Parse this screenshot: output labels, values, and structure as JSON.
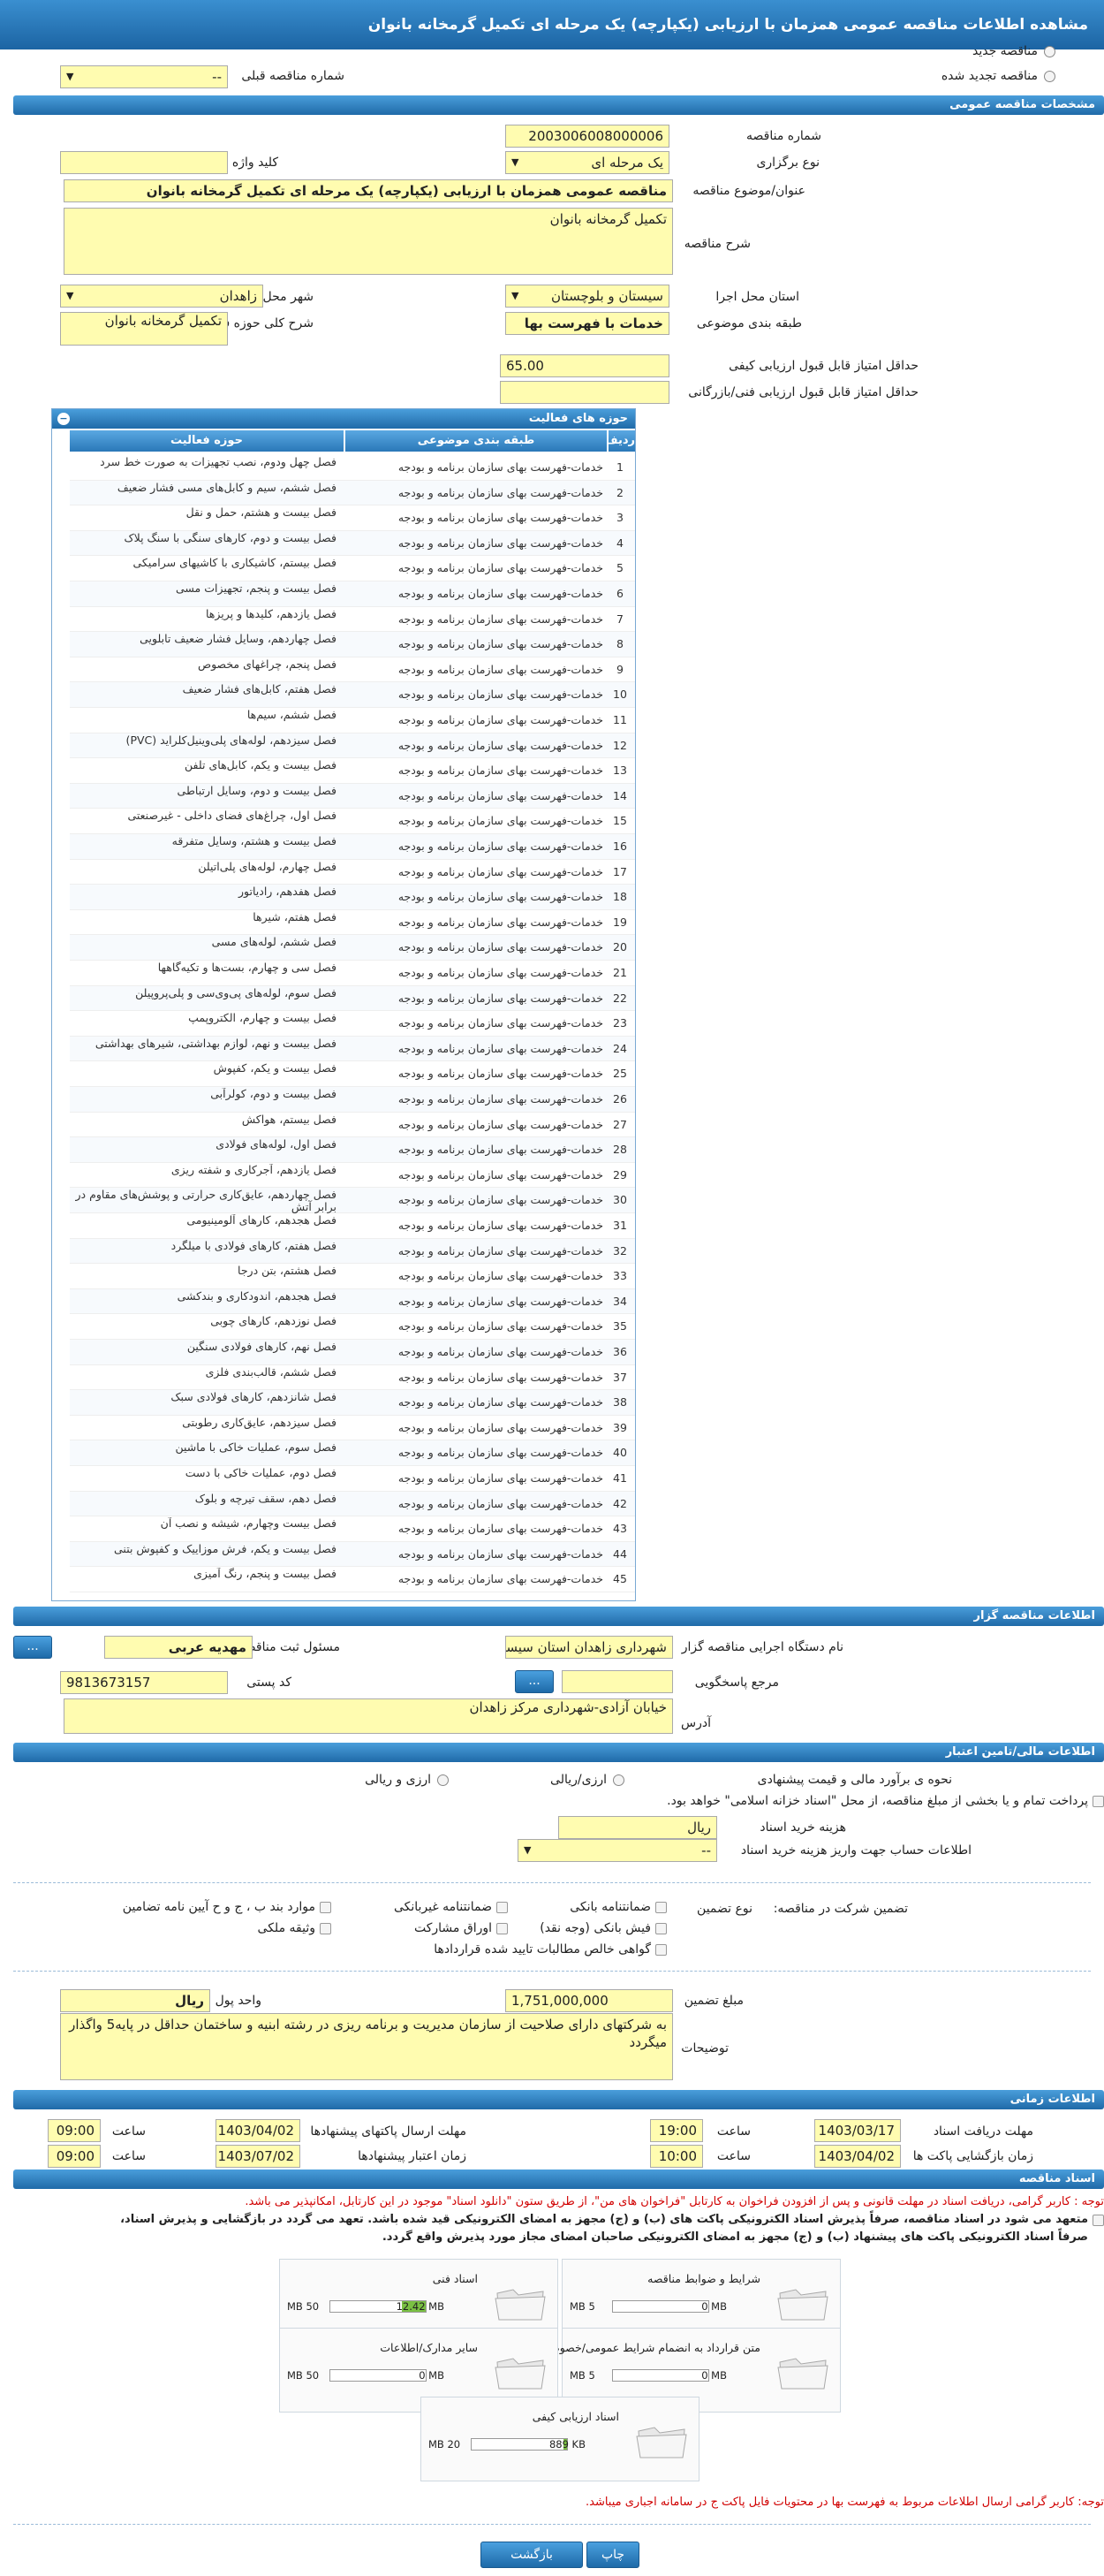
{
  "page_title": "مشاهده اطلاعات مناقصه عمومی همزمان با ارزیابی (یکپارچه) یک مرحله ای تکمیل گرمخانه بانوان",
  "top": {
    "new_tender": "مناقصه جدید",
    "renewed_tender": "مناقصه تجدید شده",
    "prev_number_label": "شماره مناقصه قبلی",
    "prev_number_value": "--"
  },
  "sections": {
    "general": "مشخصات مناقصه عمومی",
    "activity": "حوزه های فعالیت",
    "organizer": "اطلاعات مناقصه گزار",
    "financial": "اطلاعات مالی/تامین اعتبار",
    "timing": "اطلاعات زمانی",
    "docs": "اسناد مناقصه"
  },
  "general": {
    "number_label": "شماره مناقصه",
    "number": "2003006008000006",
    "type_label": "نوع برگزاری",
    "type": "یک مرحله ای",
    "keyword_label": "کلید واژه",
    "keyword": "",
    "subject_label": "عنوان/موضوع مناقصه",
    "subject": "مناقصه عمومی همزمان با ارزیابی (یکپارچه) یک مرحله ای تکمیل گرمخانه بانوان",
    "desc_label": "شرح مناقصه",
    "desc": "تکمیل گرمخانه بانوان",
    "province_label": "استان محل اجرا",
    "province": "سیستان و بلوچستان",
    "city_label": "شهر محل اجرا",
    "city": "زاهدان",
    "category_label": "طبقه بندی موضوعی",
    "category": "خدمات با فهرست بها",
    "scope_label": "شرح کلی حوزه فعالیت",
    "scope": "تکمیل گرمخانه بانوان",
    "min_quality_label": "حداقل امتیاز قابل قبول ارزیابی کیفی",
    "min_quality": "65.00",
    "min_tech_label": "حداقل امتیاز قابل قبول ارزیابی فنی/بازرگانی",
    "min_tech": ""
  },
  "activity_table": {
    "col_row": "ردیف",
    "col_cat": "طبقه بندی موضوعی",
    "col_field": "حوزه فعالیت",
    "rows": [
      {
        "n": "1",
        "cat": "خدمات-فهرست بهای سازمان برنامه و بودجه",
        "field": "فصل چهل ودوم، نصب تجهیزات به صورت خط سرد"
      },
      {
        "n": "2",
        "cat": "خدمات-فهرست بهای سازمان برنامه و بودجه",
        "field": "فصل ششم، سیم و کابل‌های مسی فشار ضعیف"
      },
      {
        "n": "3",
        "cat": "خدمات-فهرست بهای سازمان برنامه و بودجه",
        "field": "فصل بیست و هشتم، حمل و نقل"
      },
      {
        "n": "4",
        "cat": "خدمات-فهرست بهای سازمان برنامه و بودجه",
        "field": "فصل بیست و دوم، کارهای سنگی با سنگ پلاک"
      },
      {
        "n": "5",
        "cat": "خدمات-فهرست بهای سازمان برنامه و بودجه",
        "field": "فصل بیستم، کاشیکاری با کاشیهای سرامیکی"
      },
      {
        "n": "6",
        "cat": "خدمات-فهرست بهای سازمان برنامه و بودجه",
        "field": "فصل بیست و پنجم، تجهیزات مسی"
      },
      {
        "n": "7",
        "cat": "خدمات-فهرست بهای سازمان برنامه و بودجه",
        "field": "فصل یازدهم، کلیدها و پریزها"
      },
      {
        "n": "8",
        "cat": "خدمات-فهرست بهای سازمان برنامه و بودجه",
        "field": "فصل چهاردهم، وسایل فشار ضعیف تابلویی"
      },
      {
        "n": "9",
        "cat": "خدمات-فهرست بهای سازمان برنامه و بودجه",
        "field": "فصل پنجم، چراغهای مخصوص"
      },
      {
        "n": "10",
        "cat": "خدمات-فهرست بهای سازمان برنامه و بودجه",
        "field": "فصل هفتم، کابل‌های فشار ضعیف"
      },
      {
        "n": "11",
        "cat": "خدمات-فهرست بهای سازمان برنامه و بودجه",
        "field": "فصل ششم، سیم‌ها"
      },
      {
        "n": "12",
        "cat": "خدمات-فهرست بهای سازمان برنامه و بودجه",
        "field": "فصل سیزدهم، لوله‌های پلی‌وینیل‌کلراید (PVC)"
      },
      {
        "n": "13",
        "cat": "خدمات-فهرست بهای سازمان برنامه و بودجه",
        "field": "فصل بیست و یکم، کابل‌های تلفن"
      },
      {
        "n": "14",
        "cat": "خدمات-فهرست بهای سازمان برنامه و بودجه",
        "field": "فصل بیست و دوم، وسایل ارتباطی"
      },
      {
        "n": "15",
        "cat": "خدمات-فهرست بهای سازمان برنامه و بودجه",
        "field": "فصل اول، چراغ‌های فضای داخلی - غیرصنعتی"
      },
      {
        "n": "16",
        "cat": "خدمات-فهرست بهای سازمان برنامه و بودجه",
        "field": "فصل بیست و هشتم، وسایل متفرقه"
      },
      {
        "n": "17",
        "cat": "خدمات-فهرست بهای سازمان برنامه و بودجه",
        "field": "فصل چهارم، لوله‌های پلی‌اتیلن"
      },
      {
        "n": "18",
        "cat": "خدمات-فهرست بهای سازمان برنامه و بودجه",
        "field": "فصل هفدهم، رادیاتور"
      },
      {
        "n": "19",
        "cat": "خدمات-فهرست بهای سازمان برنامه و بودجه",
        "field": "فصل هفتم، شیرها"
      },
      {
        "n": "20",
        "cat": "خدمات-فهرست بهای سازمان برنامه و بودجه",
        "field": "فصل ششم، لوله‌های مسی"
      },
      {
        "n": "21",
        "cat": "خدمات-فهرست بهای سازمان برنامه و بودجه",
        "field": "فصل سی و چهارم، بست‌ها و تکیه‌گاهها"
      },
      {
        "n": "22",
        "cat": "خدمات-فهرست بهای سازمان برنامه و بودجه",
        "field": "فصل سوم، لوله‌های پی‌وی‌سی و پلی‌پروپیلن"
      },
      {
        "n": "23",
        "cat": "خدمات-فهرست بهای سازمان برنامه و بودجه",
        "field": "فصل بیست و چهارم، الکتروپمپ"
      },
      {
        "n": "24",
        "cat": "خدمات-فهرست بهای سازمان برنامه و بودجه",
        "field": "فصل بیست و نهم، لوازم بهداشتی، شیرهای بهداشتی"
      },
      {
        "n": "25",
        "cat": "خدمات-فهرست بهای سازمان برنامه و بودجه",
        "field": "فصل بیست و یکم، کفپوش"
      },
      {
        "n": "26",
        "cat": "خدمات-فهرست بهای سازمان برنامه و بودجه",
        "field": "فصل بیست و دوم، کولرآبی"
      },
      {
        "n": "27",
        "cat": "خدمات-فهرست بهای سازمان برنامه و بودجه",
        "field": "فصل بیستم، هواکش"
      },
      {
        "n": "28",
        "cat": "خدمات-فهرست بهای سازمان برنامه و بودجه",
        "field": "فصل اول، لوله‌های فولادی"
      },
      {
        "n": "29",
        "cat": "خدمات-فهرست بهای سازمان برنامه و بودجه",
        "field": "فصل یازدهم، آجرکاری و شفته ریزی"
      },
      {
        "n": "30",
        "cat": "خدمات-فهرست بهای سازمان برنامه و بودجه",
        "field": "فصل چهاردهم، عایق‌کاری حرارتی و پوشش‌های مقاوم در برابر آتش"
      },
      {
        "n": "31",
        "cat": "خدمات-فهرست بهای سازمان برنامه و بودجه",
        "field": "فصل هجدهم، کارهای آلومینیومی"
      },
      {
        "n": "32",
        "cat": "خدمات-فهرست بهای سازمان برنامه و بودجه",
        "field": "فصل هفتم، کارهای فولادی با میلگرد"
      },
      {
        "n": "33",
        "cat": "خدمات-فهرست بهای سازمان برنامه و بودجه",
        "field": "فصل هشتم، بتن درجا"
      },
      {
        "n": "34",
        "cat": "خدمات-فهرست بهای سازمان برنامه و بودجه",
        "field": "فصل هجدهم، اندودکاری و بندکشی"
      },
      {
        "n": "35",
        "cat": "خدمات-فهرست بهای سازمان برنامه و بودجه",
        "field": "فصل نوزدهم، کارهای چوبی"
      },
      {
        "n": "36",
        "cat": "خدمات-فهرست بهای سازمان برنامه و بودجه",
        "field": "فصل نهم، کارهای فولادی سنگین"
      },
      {
        "n": "37",
        "cat": "خدمات-فهرست بهای سازمان برنامه و بودجه",
        "field": "فصل ششم، قالب‌بندی فلزی"
      },
      {
        "n": "38",
        "cat": "خدمات-فهرست بهای سازمان برنامه و بودجه",
        "field": "فصل شانزدهم، کارهای فولادی سبک"
      },
      {
        "n": "39",
        "cat": "خدمات-فهرست بهای سازمان برنامه و بودجه",
        "field": "فصل سیزدهم، عایق‌کاری رطوبتی"
      },
      {
        "n": "40",
        "cat": "خدمات-فهرست بهای سازمان برنامه و بودجه",
        "field": "فصل سوم، عملیات خاکی با ماشین"
      },
      {
        "n": "41",
        "cat": "خدمات-فهرست بهای سازمان برنامه و بودجه",
        "field": "فصل دوم، عملیات خاکی با دست"
      },
      {
        "n": "42",
        "cat": "خدمات-فهرست بهای سازمان برنامه و بودجه",
        "field": "فصل دهم، سقف تیرچه و بلوک"
      },
      {
        "n": "43",
        "cat": "خدمات-فهرست بهای سازمان برنامه و بودجه",
        "field": "فصل بیست وچهارم، شیشه و نصب آن"
      },
      {
        "n": "44",
        "cat": "خدمات-فهرست بهای سازمان برنامه و بودجه",
        "field": "فصل بیست و یکم، فرش موزاییک و کفپوش بتنی"
      },
      {
        "n": "45",
        "cat": "خدمات-فهرست بهای سازمان برنامه و بودجه",
        "field": "فصل بیست و پنجم، رنگ آمیزی"
      }
    ]
  },
  "organizer": {
    "org_label": "نام دستگاه اجرایی مناقصه گزار",
    "org": "شهرداری زاهدان استان سیستان",
    "resp_label": "مسئول ثبت مناقصه",
    "resp": "مهدیه عربی",
    "ref_label": "مرجع پاسخگویی",
    "ref": "",
    "postal_label": "کد پستی",
    "postal": "9813673157",
    "address_label": "آدرس",
    "address": "خیابان آزادی-شهرداری مرکز زاهدان"
  },
  "financial": {
    "estimate_label": "نحوه ی برآورد مالی و قیمت پیشنهادی",
    "opt1": "ارزی/ریالی",
    "opt2": "ارزی و ریالی",
    "treasury_note": "پرداخت تمام و یا بخشی از مبلغ مناقصه، از محل \"اسناد خزانه اسلامی\" خواهد بود.",
    "doc_cost_label": "هزینه خرید اسناد",
    "doc_cost_unit": "ریال",
    "account_label": "اطلاعات حساب جهت واریز هزینه خرید اسناد",
    "account": "--",
    "guarantee_label": "تضمین شرکت در مناقصه:",
    "guarantee_type_label": "نوع تضمین",
    "g1": "ضمانتنامه بانکی",
    "g2": "ضمانتنامه غیربانکی",
    "g3": "موارد بند ب ، ج و ح آیین نامه تضامین",
    "g4": "فیش بانکی (وجه نقد)",
    "g5": "اوراق مشارکت",
    "g6": "وثیقه ملکی",
    "g7": "گواهی خالص مطالبات تایید شده قراردادها",
    "amount_label": "مبلغ تضمین",
    "amount": "1,751,000,000",
    "currency_label": "واحد پول",
    "currency": "ریال",
    "notes_label": "توضیحات",
    "notes": "به شرکتهای دارای صلاحیت از سازمان مدیریت و برنامه ریزی در رشته ابنیه و ساختمان حداقل در پایه5 واگذار میگردد"
  },
  "timing": {
    "doc_receive_label": "مهلت دریافت اسناد",
    "doc_receive_date": "1403/03/17",
    "doc_receive_time": "19:00",
    "send_label": "مهلت ارسال پاکتهای پیشنهادها",
    "send_date": "1403/04/02",
    "send_time": "09:00",
    "open_label": "زمان بازگشایی پاکت ها",
    "open_date": "1403/04/02",
    "open_time": "10:00",
    "valid_label": "زمان اعتبار پیشنهادها",
    "valid_date": "1403/07/02",
    "valid_time": "09:00",
    "time_label": "ساعت"
  },
  "docs": {
    "note1": "توجه : کاربر گرامی، دریافت اسناد در مهلت قانونی و پس از افزودن فراخوان به کارتابل \"فراخوان های من\"، از طریق ستون \"دانلود اسناد\" موجود در این کارتابل، امکانپذیر می باشد.",
    "note2": "متعهد می شود در اسناد مناقصه، صرفاً پذیرش اسناد الکترونیکی پاکت های (ب) و (ج) مجهز به امضای الکترونیکی قید شده باشد. تعهد می گردد در بازگشایی و پذیرش اسناد،",
    "note3": "صرفاً اسناد الکترونیکی پاکت های پیشنهاد (ب) و (ج) مجهز به امضای الکترونیکی صاحبان امضای مجاز مورد پذیرش واقع گردد.",
    "files": [
      {
        "name": "شرایط و ضوابط مناقصه",
        "used": "0 MB",
        "cap": "5 MB",
        "pct": 0
      },
      {
        "name": "اسناد فنی",
        "used": "12.42 MB",
        "cap": "50 MB",
        "pct": 0.25
      },
      {
        "name": "متن قرارداد به انضمام شرایط عمومی/خصوصی",
        "used": "0 MB",
        "cap": "5 MB",
        "pct": 0
      },
      {
        "name": "سایر مدارک/اطلاعات",
        "used": "0 MB",
        "cap": "50 MB",
        "pct": 0
      },
      {
        "name": "اسناد ارزیابی کیفی",
        "used": "889 KB",
        "cap": "20 MB",
        "pct": 0.04
      }
    ],
    "note4": "توجه: کاربر گرامی ارسال اطلاعات مربوط به فهرست بها در محتویات فایل پاکت ج در سامانه اجباری میباشد."
  },
  "buttons": {
    "back": "بازگشت",
    "print": "چاپ",
    "dots": "..."
  },
  "colors": {
    "header": "#1f6aa8",
    "field": "#fffcb0",
    "accent_red": "#d00000",
    "progress": "#7ac043"
  }
}
